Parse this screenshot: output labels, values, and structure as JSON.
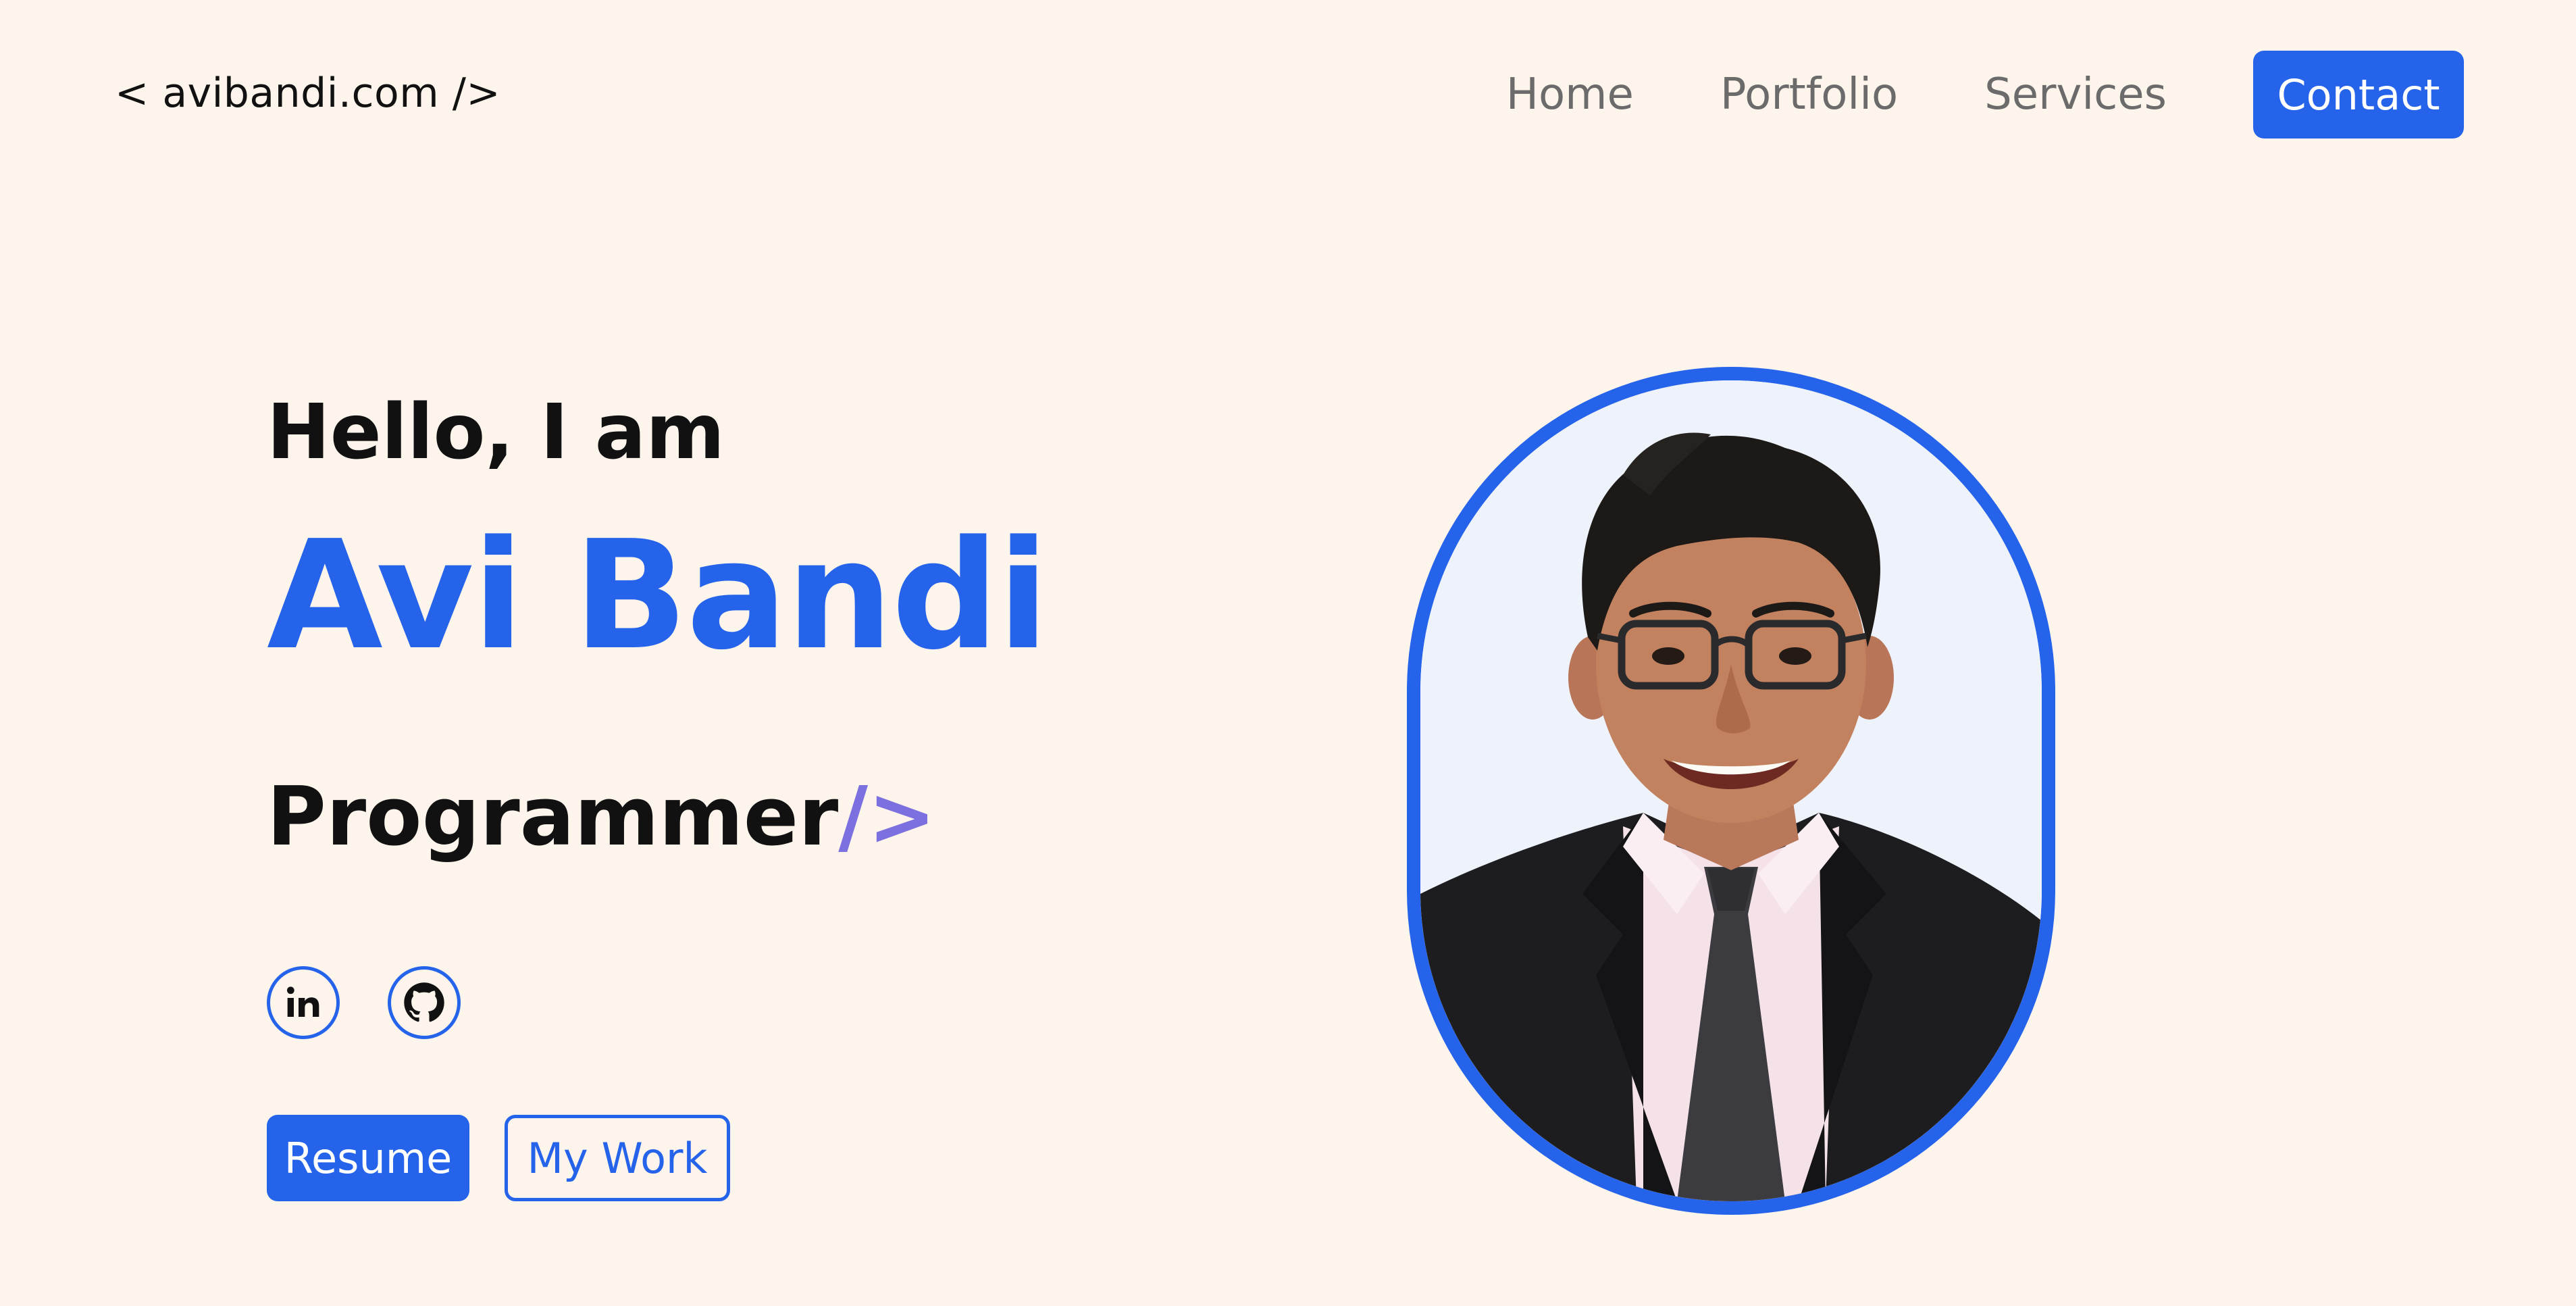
{
  "header": {
    "logo": "< avibandi.com />",
    "nav": {
      "home": "Home",
      "portfolio": "Portfolio",
      "services": "Services",
      "contact": "Contact"
    }
  },
  "hero": {
    "greeting": "Hello, I am",
    "name": "Avi Bandi",
    "role": "Programmer",
    "role_suffix": "/>",
    "social": {
      "linkedin_label": "in"
    },
    "buttons": {
      "resume": "Resume",
      "my_work": "My Work"
    },
    "portrait": {
      "subject": "profile photo"
    }
  },
  "colors": {
    "background": "#fdf5ec",
    "accent": "#2563eb",
    "role_accent": "#7c6fe0",
    "nav_text": "#6b6b6b"
  },
  "icons": [
    "linkedin-icon",
    "github-icon"
  ]
}
